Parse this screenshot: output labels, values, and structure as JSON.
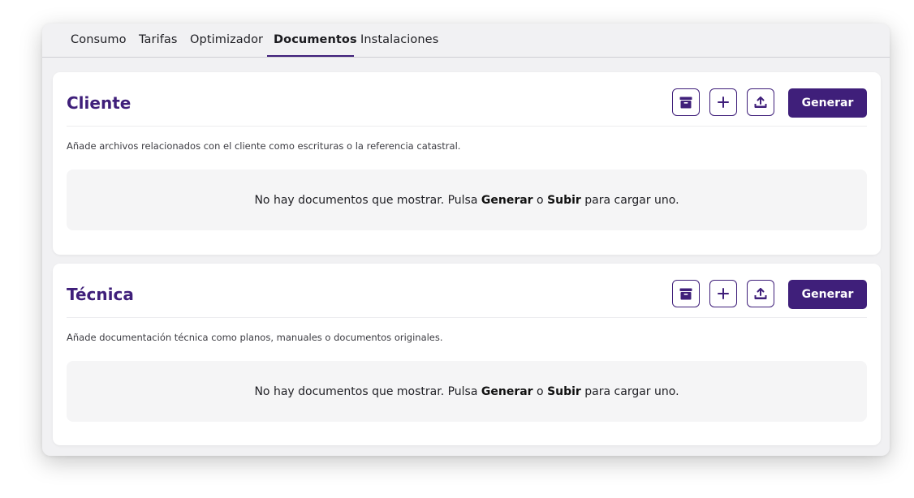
{
  "tabs": [
    {
      "label": "Consumo",
      "active": false
    },
    {
      "label": "Tarifas",
      "active": false
    },
    {
      "label": "Optimizador",
      "active": false
    },
    {
      "label": "Documentos",
      "active": true
    },
    {
      "label": "Instalaciones",
      "active": false
    }
  ],
  "sections": [
    {
      "title": "Cliente",
      "description": "Añade archivos relacionados con el cliente como escrituras o la referencia catastral.",
      "actions": {
        "archive_icon": "archive-icon",
        "add_icon": "plus-icon",
        "upload_icon": "upload-icon",
        "generate_label": "Generar"
      },
      "empty": {
        "prefix": "No hay documentos que mostrar. Pulsa ",
        "generate": "Generar",
        "middle": " o ",
        "upload": "Subir",
        "suffix": " para cargar uno."
      }
    },
    {
      "title": "Técnica",
      "description": "Añade documentación técnica como planos, manuales o documentos originales.",
      "actions": {
        "archive_icon": "archive-icon",
        "add_icon": "plus-icon",
        "upload_icon": "upload-icon",
        "generate_label": "Generar"
      },
      "empty": {
        "prefix": "No hay documentos que mostrar. Pulsa ",
        "generate": "Generar",
        "middle": " o ",
        "upload": "Subir",
        "suffix": " para cargar uno."
      }
    }
  ],
  "colors": {
    "accent": "#3f1f7a",
    "window_bg": "#f1f1f3",
    "card_bg": "#ffffff",
    "empty_bg": "#f5f5f6"
  }
}
